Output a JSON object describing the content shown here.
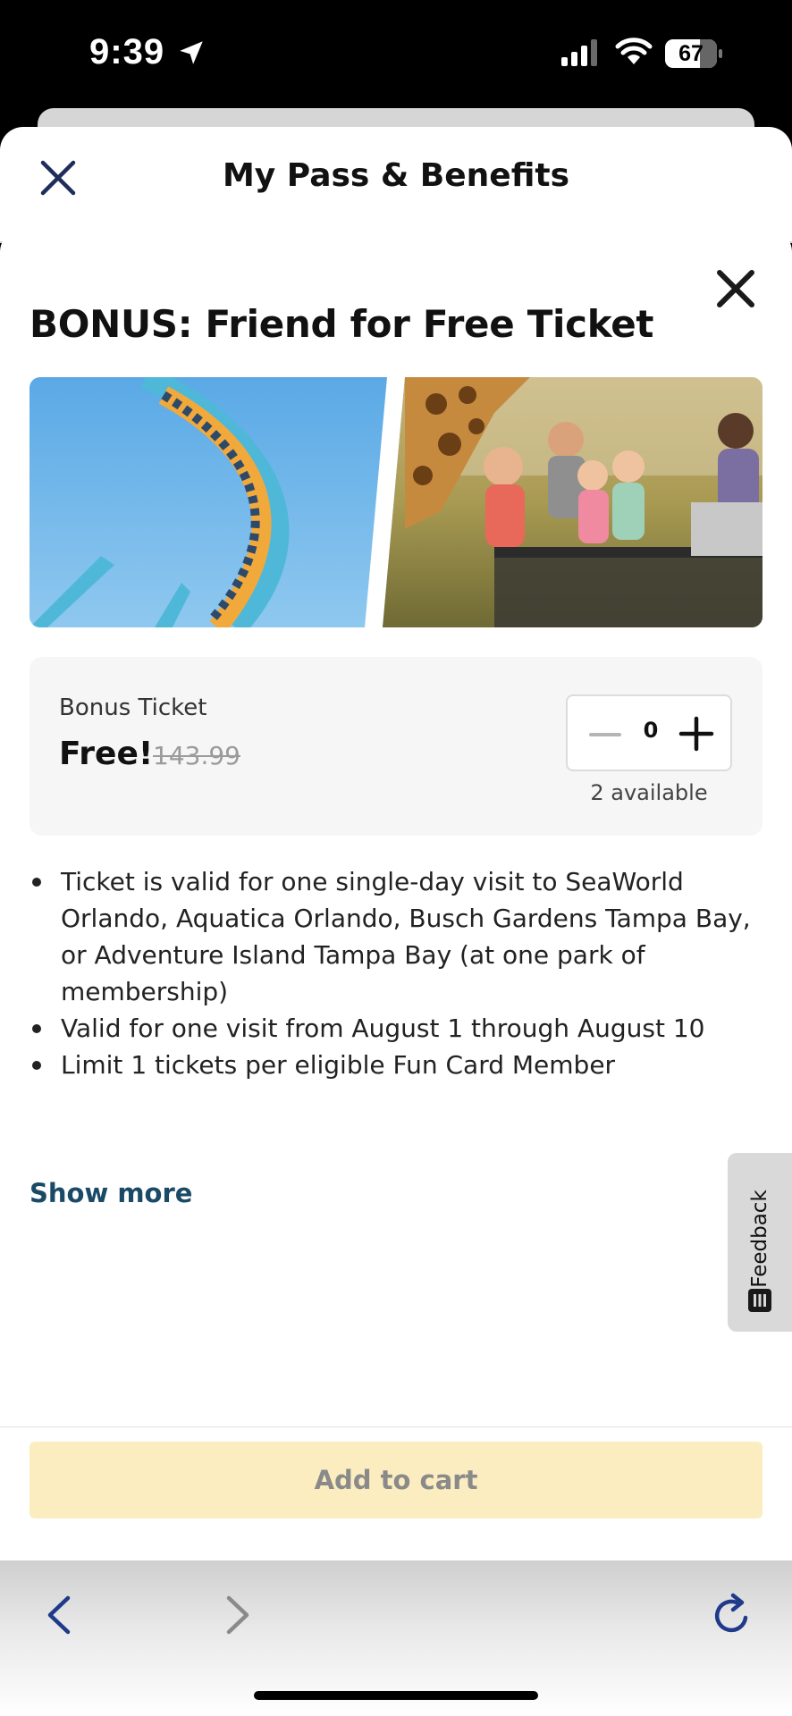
{
  "status_bar": {
    "time": "9:39",
    "battery": "67"
  },
  "header": {
    "title": "My Pass & Benefits"
  },
  "modal": {
    "title": "BONUS: Friend for Free Ticket",
    "ticket": {
      "label": "Bonus Ticket",
      "price": "Free!",
      "original_price": "143.99",
      "quantity": "0",
      "availability": "2 available"
    },
    "bullets": [
      "Ticket is valid for one single-day visit to SeaWorld Orlando, Aquatica Orlando, Busch Gardens Tampa Bay, or Adventure Island Tampa Bay (at one park of membership)",
      "Valid for one visit from August 1 through August 10",
      "Limit 1 tickets per eligible Fun Card Member"
    ],
    "show_more": "Show more",
    "add_to_cart": "Add to cart"
  },
  "feedback_tab": {
    "label": "Feedback"
  },
  "icons": {
    "close": "close-icon",
    "minus": "minus-icon",
    "plus": "plus-icon",
    "back": "chevron-left-icon",
    "forward": "chevron-right-icon",
    "reload": "reload-icon"
  },
  "colors": {
    "navy": "#1f2d5c",
    "link": "#1a4a66",
    "cart_disabled_bg": "#fbedbf",
    "cart_disabled_text": "#8a8a8a",
    "card_bg": "#f6f6f6"
  }
}
